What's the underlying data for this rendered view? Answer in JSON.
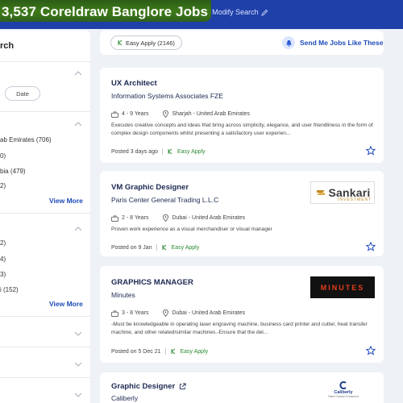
{
  "header": {
    "title": "3,537 Coreldraw Banglore Jobs",
    "modify_label": "Modify Search"
  },
  "sidebar": {
    "search_label": "rch",
    "date_label": "Date",
    "groups": [
      {
        "items": [
          "ab Emirates (706)",
          "0)",
          "bia (479)",
          "2)"
        ],
        "view_more": "View More"
      },
      {
        "items": [
          "2)",
          "4)",
          "3)",
          "i (152)"
        ],
        "view_more": "View More"
      }
    ]
  },
  "toolbar": {
    "easy_apply_label": "Easy Apply (2146)",
    "send_jobs_label": "Send Me Jobs Like These"
  },
  "jobs": [
    {
      "title": "UX Architect",
      "company": "Information Systems Associates FZE",
      "experience": "4 - 9 Years",
      "location": "Sharjah - United Arab Emirates",
      "description": "Executes creative concepts and ideas that bring across simplicity, elegance, and user friendliness in the form of complex design components whilst presenting a satisfactory user experien...",
      "posted": "Posted 3 days ago",
      "easy_apply": "Easy Apply"
    },
    {
      "title": "VM Graphic Designer",
      "company": "Paris Center General Trading L.L.C",
      "experience": "2 - 8 Years",
      "location": "Dubai - United Arab Emirates",
      "description": "Proven work experience as a visual merchandiser or visual manager",
      "posted": "Posted on 9 Jan",
      "easy_apply": "Easy Apply",
      "logo_text": "Sankari",
      "logo_sub": "INVESTMENT"
    },
    {
      "title": "GRAPHICS MANAGER",
      "company": "Minutes",
      "experience": "3 - 8 Years",
      "location": "Dubai - United Arab Emirates",
      "description": "-Must be knowledgeable in operating laser engraving machine, business card printer and cutter, heat transfer machine, and other related/similar machines.-Ensure that the del...",
      "posted": "Posted on 5 Dec 21",
      "easy_apply": "Easy Apply",
      "logo_text": "MINUTES"
    },
    {
      "title": "Graphic Designer",
      "company": "Caliberly",
      "logo_text": "Caliberly",
      "logo_sub": "Talent Search Enhanced"
    }
  ],
  "colors": {
    "header_blue": "#1f3fa9",
    "highlight_green": "#3e7a18",
    "link_blue": "#1e4bb8",
    "easy_apply_green": "#2e8b34",
    "title_navy": "#1c2a52"
  },
  "icons": [
    "pencil-icon",
    "chevron-up-icon",
    "chevron-down-icon",
    "easy-apply-icon",
    "bell-icon",
    "briefcase-icon",
    "location-pin-icon",
    "star-icon",
    "external-link-icon"
  ]
}
